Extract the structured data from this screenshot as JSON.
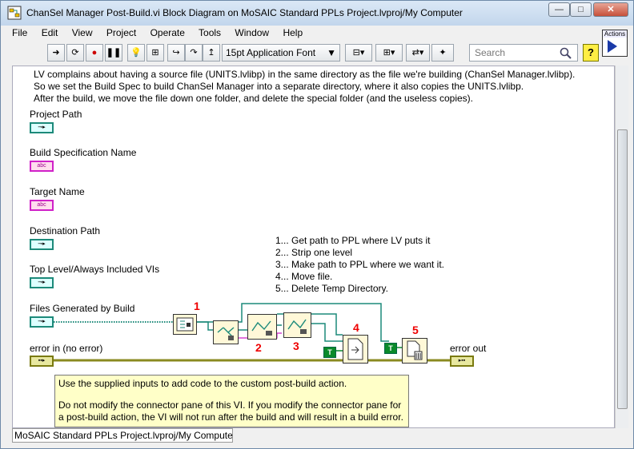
{
  "window": {
    "title": "ChanSel Manager Post-Build.vi Block Diagram on MoSAIC Standard PPLs Project.lvproj/My Computer",
    "minimize": "—",
    "maximize": "□",
    "close": "✕"
  },
  "menu": [
    "File",
    "Edit",
    "View",
    "Project",
    "Operate",
    "Tools",
    "Window",
    "Help"
  ],
  "toolbar": {
    "font": "15pt Application Font",
    "search_placeholder": "Search",
    "help": "?"
  },
  "actions_icon_label": "Actions",
  "comment_lines": [
    "LV complains about having a source file (UNITS.lvlibp) in the same directory as the file we're building (ChanSel Manager.lvlibp).",
    "So we set the Build Spec to build ChanSel Manager into a separate directory, where it also copies the UNITS.lvlibp.",
    "After the build, we move the file down one folder, and delete the special folder (and the useless copies)."
  ],
  "controls": [
    {
      "label": "Project Path",
      "kind": "path"
    },
    {
      "label": "Build Specification Name",
      "kind": "string",
      "glyph": "abc"
    },
    {
      "label": "Target Name",
      "kind": "string",
      "glyph": "abc"
    },
    {
      "label": "Destination Path",
      "kind": "path"
    },
    {
      "label": "Top Level/Always Included VIs",
      "kind": "path"
    },
    {
      "label": "Files Generated by Build",
      "kind": "path"
    }
  ],
  "error_in": "error in (no error)",
  "error_out": "error out",
  "steps": [
    "1... Get path to PPL where LV puts it",
    "2... Strip one level",
    "3... Make path to PPL where we want it.",
    "4... Move file.",
    "5... Delete Temp Directory."
  ],
  "step_numbers": [
    "1",
    "2",
    "3",
    "4",
    "5"
  ],
  "bool_constant": "T",
  "note": {
    "line1": "Use the supplied inputs to add code to the custom post-build action.",
    "line2": "Do not modify the connector pane of this VI.  If you modify the connector pane for",
    "line3": "a post-build action, the VI will not run after the build and will result in a build error."
  },
  "status": "MoSAIC Standard PPLs Project.lvproj/My Computer"
}
